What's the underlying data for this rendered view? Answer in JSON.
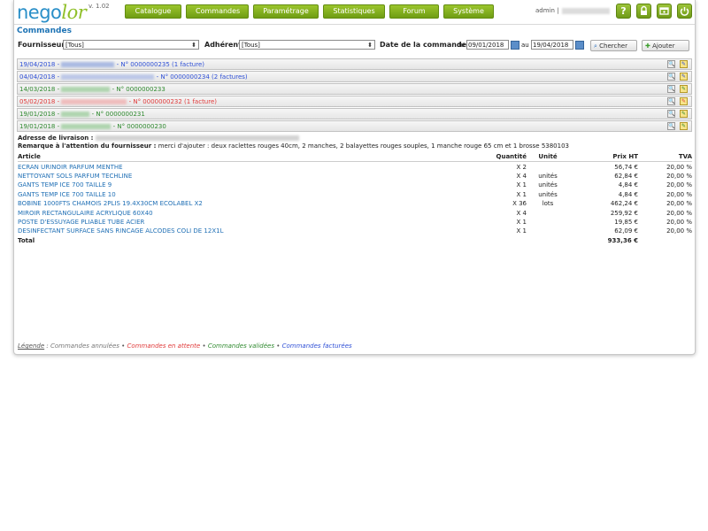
{
  "app": {
    "logo_part1": "nego",
    "logo_part2": "lor",
    "version": "v. 1.02",
    "user": "admin |"
  },
  "nav": [
    "Catalogue",
    "Commandes",
    "Paramétrage",
    "Statistiques",
    "Forum",
    "Système"
  ],
  "header_icons": [
    "help-icon",
    "lock-icon",
    "window-icon",
    "power-icon"
  ],
  "page": {
    "title": "Commandes"
  },
  "filters": {
    "fournisseur_label": "Fournisseur",
    "fournisseur_value": "[Tous]",
    "adherent_label": "Adhérent",
    "adherent_value": "[Tous]",
    "date_label": "Date de la commande",
    "du_label": "du",
    "date_from": "09/01/2018",
    "au_label": "au",
    "date_to": "19/04/2018",
    "search_label": "Chercher",
    "add_label": "Ajouter"
  },
  "orders": [
    {
      "date": "19/04/2018",
      "text": "- N° 0000000235 (1 facture)",
      "status_color": "#2e4fd6"
    },
    {
      "date": "04/04/2018",
      "text": "- N° 0000000234 (2 factures)",
      "status_color": "#2e4fd6"
    },
    {
      "date": "14/03/2018",
      "text": "- N° 0000000233",
      "status_color": "#2f8a2f"
    },
    {
      "date": "05/02/2018",
      "text": "- N° 0000000232 (1 facture)",
      "status_color": "#e03a3a"
    },
    {
      "date": "19/01/2018",
      "text": "- N° 0000000231",
      "status_color": "#2f8a2f"
    },
    {
      "date": "19/01/2018",
      "text": "- N° 0000000230",
      "status_color": "#2f8a2f"
    }
  ],
  "details": {
    "address_label": "Adresse de livraison :",
    "remark_label": "Remarque à l'attention du fournisseur :",
    "remark_text": "merci d'ajouter : deux raclettes rouges 40cm, 2 manches, 2 balayettes rouges souples, 1 manche rouge 65 cm et 1 brosse 5380103"
  },
  "table": {
    "headers": [
      "Article",
      "Quantité",
      "Unité",
      "Prix HT",
      "TVA"
    ],
    "rows": [
      [
        "ECRAN URINOIR PARFUM MENTHE",
        "X 2",
        "",
        "56,74 €",
        "20,00 %"
      ],
      [
        "NETTOYANT SOLS PARFUM TECHLINE",
        "X 4",
        "unités",
        "62,84 €",
        "20,00 %"
      ],
      [
        "GANTS TEMP ICE 700 TAILLE 9",
        "X 1",
        "unités",
        "4,84 €",
        "20,00 %"
      ],
      [
        "GANTS TEMP ICE 700 TAILLE 10",
        "X 1",
        "unités",
        "4,84 €",
        "20,00 %"
      ],
      [
        "BOBINE 1000FTS CHAMOIS 2PLIS 19.4X30CM ECOLABEL X2",
        "X 36",
        "lots",
        "462,24 €",
        "20,00 %"
      ],
      [
        "MIROIR RECTANGULAIRE ACRYLIQUE 60X40",
        "X 4",
        "",
        "259,92 €",
        "20,00 %"
      ],
      [
        "POSTE D'ESSUYAGE PLIABLE TUBE ACIER",
        "X 1",
        "",
        "19,85 €",
        "20,00 %"
      ],
      [
        "DESINFECTANT SURFACE SANS RINCAGE ALCODES COLI DE 12X1L",
        "X 1",
        "",
        "62,09 €",
        "20,00 %"
      ]
    ],
    "total_label": "Total",
    "total_value": "933,36 €"
  },
  "legend": {
    "label": "Légende",
    "items": [
      {
        "text": "Commandes annulées",
        "color": "#777777"
      },
      {
        "text": "Commandes en attente",
        "color": "#e03a3a"
      },
      {
        "text": "Commandes validées",
        "color": "#2f8a2f"
      },
      {
        "text": "Commandes facturées",
        "color": "#2e4fd6"
      }
    ]
  }
}
